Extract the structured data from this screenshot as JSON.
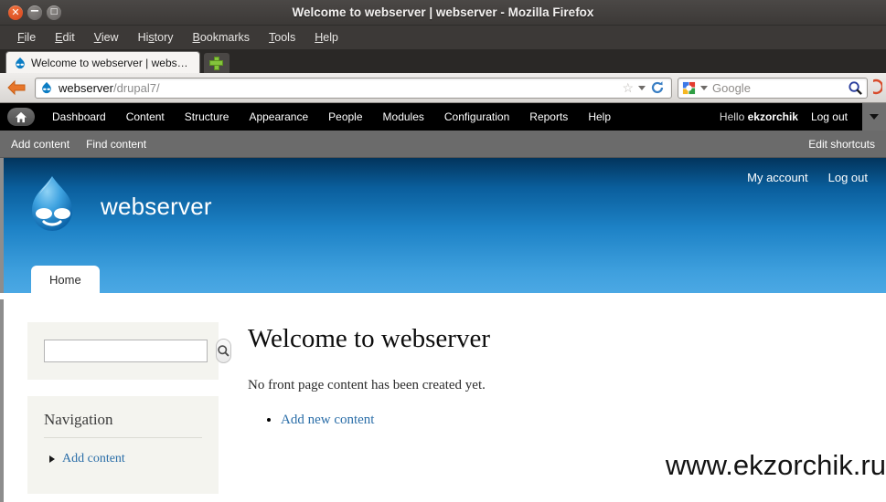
{
  "window": {
    "title": "Welcome to webserver | webserver - Mozilla Firefox",
    "close_glyph": "✕",
    "minimize_glyph": "−",
    "maximize_glyph": "□"
  },
  "menubar": {
    "items": [
      {
        "name": "file",
        "pre": "F",
        "rest": "ile"
      },
      {
        "name": "edit",
        "pre": "E",
        "rest": "dit"
      },
      {
        "name": "view",
        "pre": "V",
        "rest": "iew"
      },
      {
        "name": "history",
        "pre": "Hi",
        "mid": "s",
        "rest": "tory"
      },
      {
        "name": "bookmarks",
        "pre": "B",
        "rest": "ookmarks"
      },
      {
        "name": "tools",
        "pre": "T",
        "rest": "ools"
      },
      {
        "name": "help",
        "pre": "H",
        "rest": "elp"
      }
    ]
  },
  "browser": {
    "tab_title": "Welcome to webserver | webs…",
    "new_tab_label": "+",
    "url": "webserver",
    "url_path": "/drupal7/",
    "search_placeholder": "Google",
    "star_glyph": "☆",
    "reload_glyph": "↻",
    "magnifier_glyph": "⌕",
    "back_glyph": "←"
  },
  "admin_toolbar": {
    "home_glyph": "⌂",
    "items": [
      "Dashboard",
      "Content",
      "Structure",
      "Appearance",
      "People",
      "Modules",
      "Configuration",
      "Reports",
      "Help"
    ],
    "greeting_prefix": "Hello ",
    "username": "ekzorchik",
    "logout": "Log out"
  },
  "shortcuts": {
    "items": [
      "Add content",
      "Find content"
    ],
    "edit": "Edit shortcuts"
  },
  "site_header": {
    "site_name": "webserver",
    "links": [
      "My account",
      "Log out"
    ],
    "tab": "Home"
  },
  "sidebar": {
    "search": {
      "value": "",
      "placeholder": "",
      "button_glyph": "⌕"
    },
    "navigation": {
      "title": "Navigation",
      "items": [
        "Add content"
      ]
    }
  },
  "main": {
    "title": "Welcome to webserver",
    "empty_message": "No front page content has been created yet.",
    "actions": [
      "Add new content"
    ]
  },
  "watermark": "www.ekzorchik.ru",
  "colors": {
    "titlebar": "#3c3937",
    "admin_bar": "#000000",
    "shortcut_bar": "#6b6b6b",
    "header_blue_top": "#02345c",
    "header_blue_bottom": "#4ba8e4",
    "link_blue": "#2b6ea8",
    "block_bg": "#f4f4ef"
  }
}
